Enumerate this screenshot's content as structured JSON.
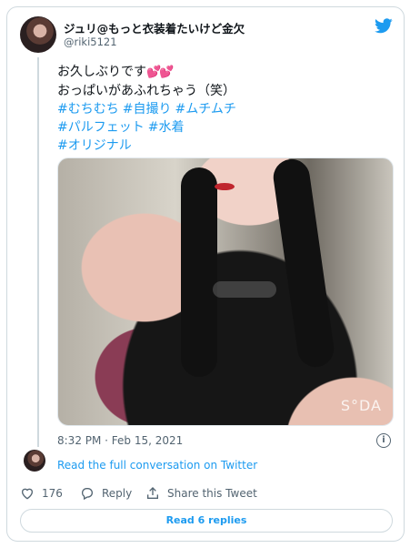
{
  "author": {
    "name": "ジュリ@もっと衣装着たいけど金欠",
    "handle": "@riki5121"
  },
  "tweet": {
    "line1": "お久しぶりです",
    "line1_emoji": "💕💕",
    "line2": "おっぱいがあふれちゃう（笑）",
    "hashtags_row1": [
      "#むちむち",
      "#自撮り",
      "#ムチムチ"
    ],
    "hashtags_row2": [
      "#パルフェット",
      "#水着"
    ],
    "hashtags_row3": [
      "#オリジナル"
    ]
  },
  "photo": {
    "watermark": "S°DA"
  },
  "timestamp": "8:32 PM · Feb 15, 2021",
  "read_link": "Read the full conversation on Twitter",
  "actions": {
    "like_count": "176",
    "reply_label": "Reply",
    "share_label": "Share this Tweet"
  },
  "replies_button": "Read 6 replies",
  "colors": {
    "accent": "#1d9bf0",
    "muted": "#536471",
    "border": "#cfd9de"
  }
}
